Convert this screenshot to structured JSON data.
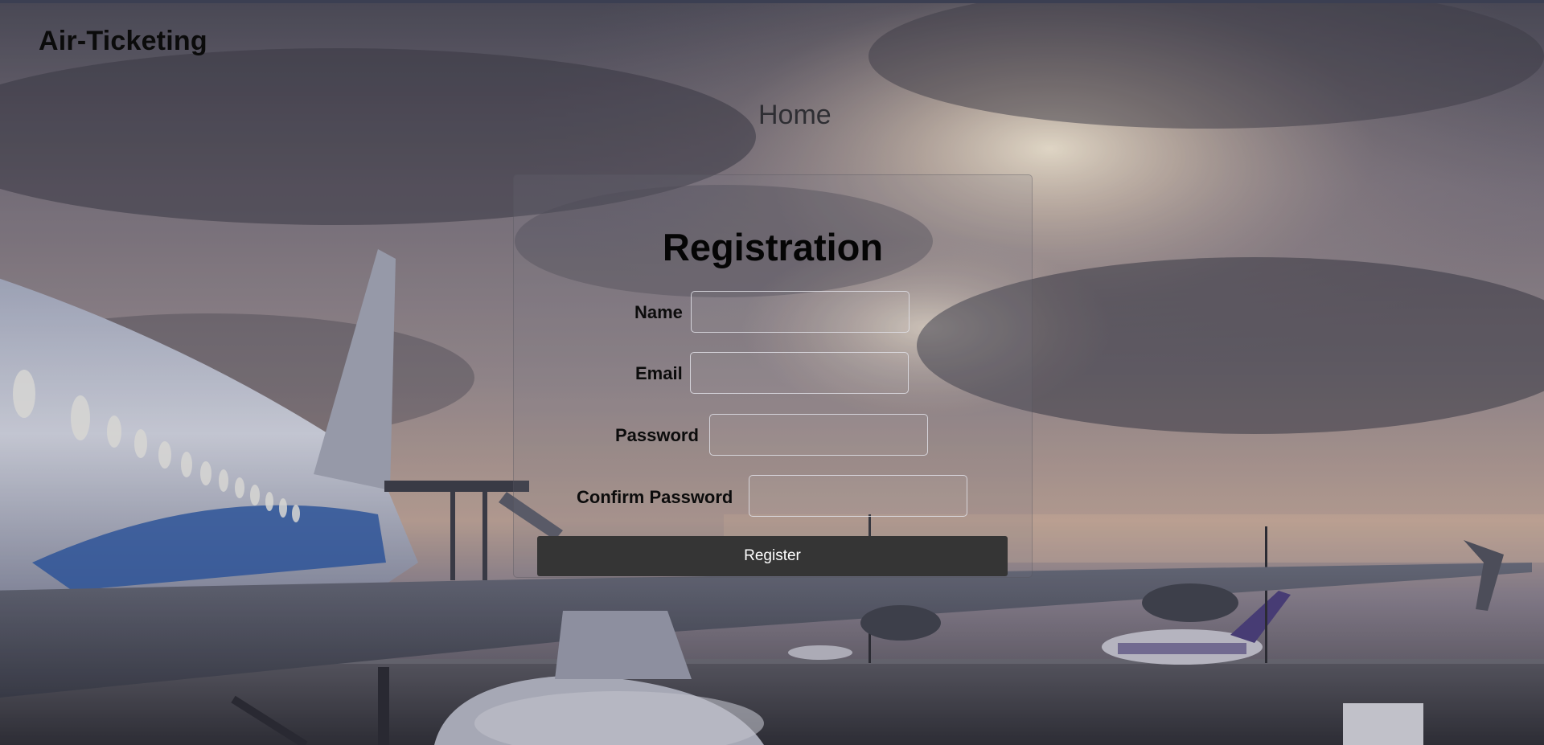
{
  "brand": {
    "title": "Air-Ticketing"
  },
  "nav": {
    "home_label": "Home"
  },
  "form": {
    "title": "Registration",
    "fields": [
      {
        "label": "Name",
        "value": "",
        "placeholder": ""
      },
      {
        "label": "Email",
        "value": "",
        "placeholder": ""
      },
      {
        "label": "Password",
        "value": "",
        "placeholder": ""
      },
      {
        "label": "Confirm Password",
        "value": "",
        "placeholder": ""
      }
    ],
    "submit_label": "Register"
  },
  "colors": {
    "top_rule": "#3b3f52",
    "button_bg": "#353535",
    "button_text": "#ffffff",
    "label_text": "#0c0c0c"
  },
  "background": {
    "image_subject": "parked airliner on an airport apron at dusk under a cloudy sky"
  }
}
